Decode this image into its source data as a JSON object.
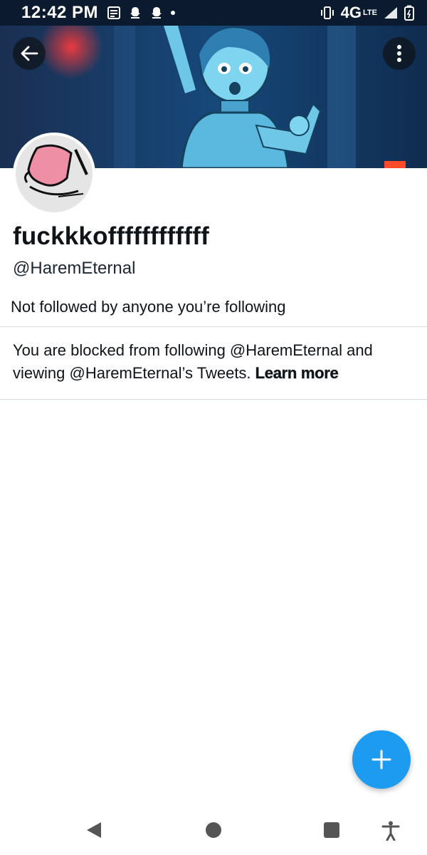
{
  "status_bar": {
    "time": "12:42 PM",
    "network": "4G",
    "network_sub": "LTE",
    "icons": [
      "news-icon",
      "snapchat-icon",
      "snapchat-icon",
      "dot-icon",
      "vibrate-icon",
      "signal-icon",
      "battery-icon"
    ]
  },
  "header": {
    "back_icon": "arrow-left-icon",
    "more_icon": "more-vertical-icon"
  },
  "profile": {
    "display_name": "fuckkkoffffffffffff",
    "handle": "@HaremEternal",
    "followed_by": "Not followed by anyone you’re following"
  },
  "blocked": {
    "text": "You are blocked from following @HaremEternal and viewing @HaremEternal’s Tweets. ",
    "learn_more": "Learn more"
  },
  "fab": {
    "icon": "plus-icon"
  },
  "nav": {
    "items": [
      "back-triangle-icon",
      "home-circle-icon",
      "recents-square-icon",
      "accessibility-icon"
    ]
  },
  "colors": {
    "accent": "#1d9bf0",
    "status_bar_bg": "#0b1a2e",
    "text": "#0f1419",
    "divider": "#d6dde3"
  }
}
